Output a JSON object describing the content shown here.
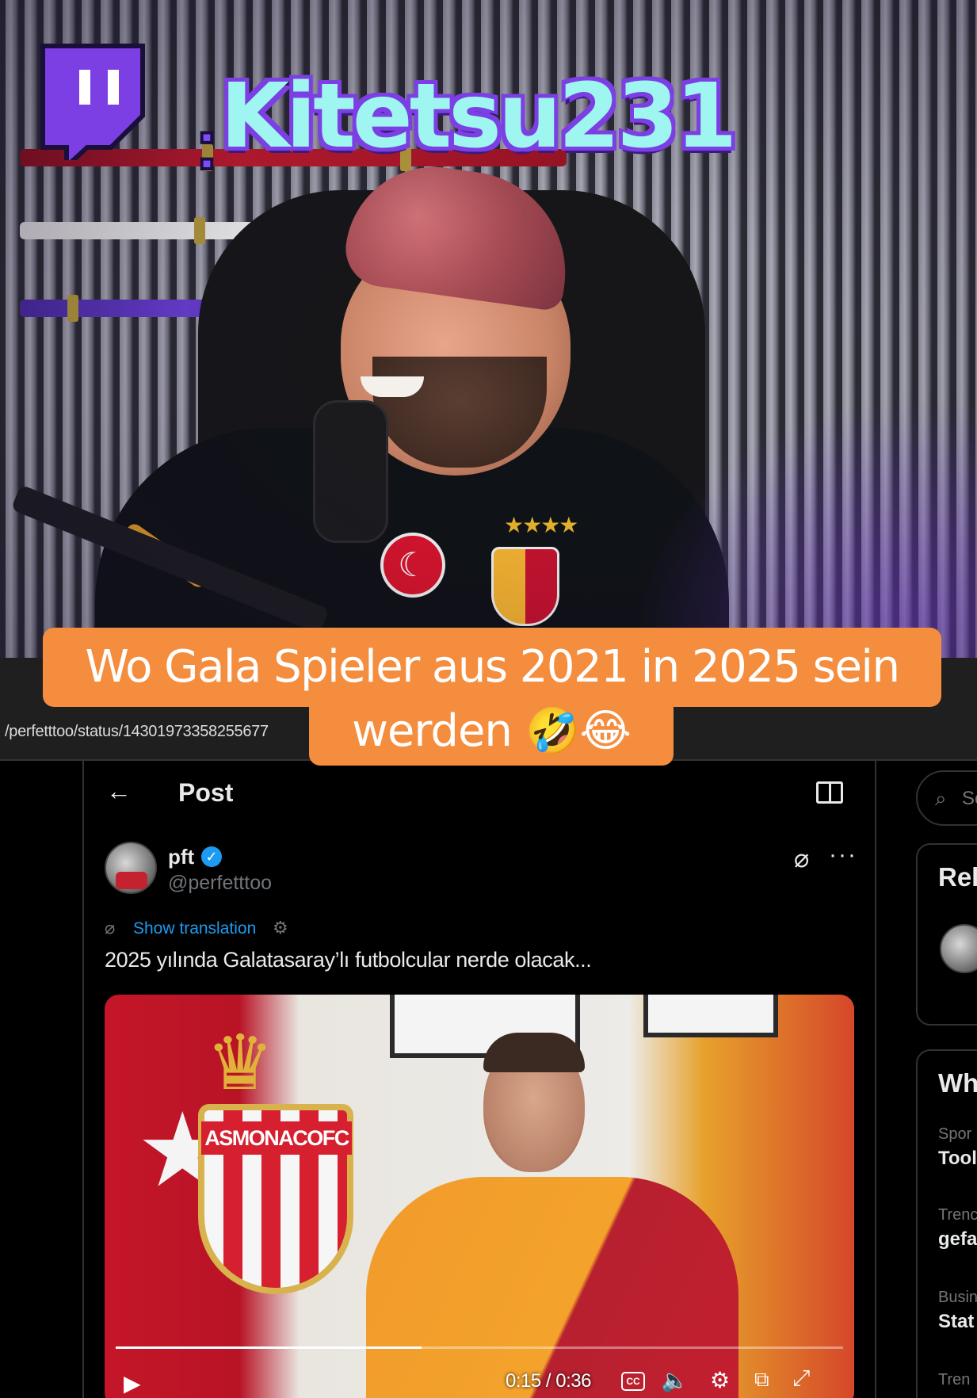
{
  "stream_overlay": {
    "platform_icon": "twitch-logo-icon",
    "separator": ":",
    "channel_name": "Kitetsu231"
  },
  "caption": {
    "line1": "Wo Gala Spieler aus 2021 in 2025 sein",
    "line2": "werden 🤣😂"
  },
  "browser": {
    "url_partial": "/perfetttoo/status/14301973358255677"
  },
  "post_header": {
    "back_icon": "back-arrow-icon",
    "title": "Post",
    "reader_icon": "reader-mode-icon"
  },
  "tweet": {
    "display_name": "pft",
    "verified": true,
    "handle": "@perfetttoo",
    "show_translation": "Show translation",
    "text": "2025 yılında Galatasaray’lı futbolcular nerde olacak...",
    "video": {
      "club_crest_text": "ASMONACOFC",
      "current_time": "0:15",
      "duration": "0:36",
      "time_display": "0:15 / 0:36",
      "progress_fraction": 0.42,
      "cc_label": "CC"
    }
  },
  "sidebar": {
    "search_placeholder": "Se",
    "relevant_heading": "Rel",
    "whats_heading": "Wh",
    "trends": [
      {
        "context": "Spor",
        "title": "Tool"
      },
      {
        "context": "Trenc",
        "title": "gefa"
      },
      {
        "context": "Busin",
        "title": "Stat"
      },
      {
        "context": "Tren",
        "title": ""
      }
    ]
  },
  "colors": {
    "caption_bg": "#f58d3f",
    "twitch_purple": "#7b3fe4",
    "channel_name_fill": "#9ff6f0",
    "x_link_blue": "#1d9bf0",
    "x_secondary_text": "#71767b"
  }
}
